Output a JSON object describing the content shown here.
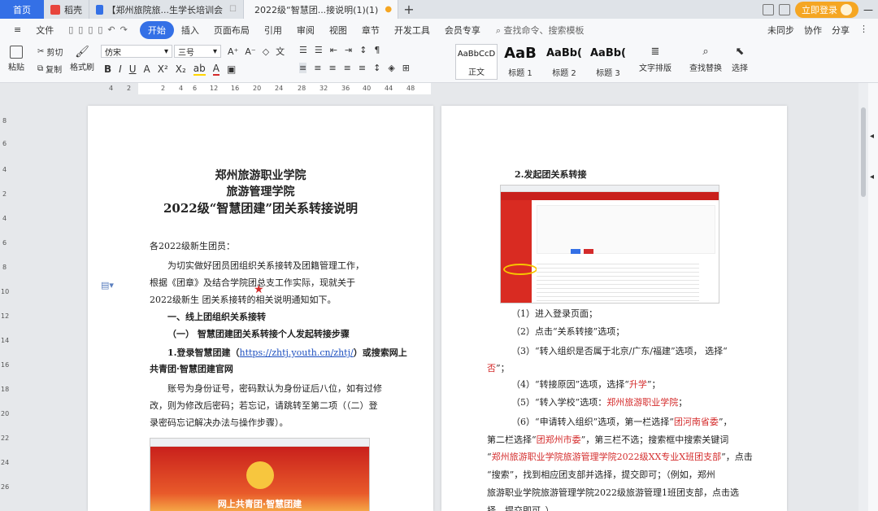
{
  "tabs": {
    "home": "首页",
    "t1": "稻壳",
    "t2": "【郑州旅院旅...生学长培训会",
    "t3": "2022级“智慧团...接说明(1)(1)",
    "add": "+",
    "login": "立即登录"
  },
  "menu": {
    "file": "文件",
    "items": [
      "开始",
      "插入",
      "页面布局",
      "引用",
      "审阅",
      "视图",
      "章节",
      "开发工具",
      "会员专享"
    ],
    "search": "查找命令、搜索模板",
    "right": [
      "未同步",
      "协作",
      "分享"
    ]
  },
  "ribbon": {
    "paste": "粘贴",
    "cut": "剪切",
    "copy": "复制",
    "format_painter": "格式刷",
    "font": "仿宋",
    "size": "三号",
    "styles": [
      {
        "preview": "AaBbCcD",
        "name": "正文"
      },
      {
        "preview": "AaB",
        "name": "标题 1"
      },
      {
        "preview": "AaBb(",
        "name": "标题 2"
      },
      {
        "preview": "AaBb(",
        "name": "标题 3"
      }
    ],
    "text_layout": "文字排版",
    "find_replace": "查找替换",
    "select": "选择"
  },
  "ruler": {
    "h": [
      "4",
      "2",
      "2",
      "4",
      "6",
      "8",
      "12",
      "16",
      "20",
      "24",
      "28",
      "32",
      "36",
      "40",
      "44",
      "48"
    ],
    "v": [
      "8",
      "6",
      "4",
      "2",
      "4",
      "6",
      "8",
      "10",
      "12",
      "14",
      "16",
      "18",
      "20",
      "22",
      "24",
      "26"
    ]
  },
  "left_page": {
    "title1": "郑州旅游职业学院",
    "title2": "旅游管理学院",
    "title3": "2022级“智慧团建”团关系转接说明",
    "greeting": "各2022级新生团员：",
    "p1": "为切实做好团员团组织关系接转及团籍管理工作，",
    "p2": "根据《团章》及结合学院团总支工作实际，现就关于",
    "p3": "2022级新生 团关系接转的相关说明通知如下。",
    "h1": "一、线上团组织关系接转",
    "h2": "（一）  智慧团建团关系转接个人发起转接步骤",
    "h3_prefix": "1.登录智慧团建（",
    "h3_link": "https://zhtj.youth.cn/zhtj/",
    "h3_suffix": "）或搜索网上",
    "h3b": "共青团·智慧团建官网",
    "p4": "账号为身份证号，密码默认为身份证后八位，如有过修",
    "p5": "改，则为修改后密码；若忘记，请跳转至第二项（（二）登",
    "p6": "录密码忘记解决办法与操作步骤）。",
    "banner": "网上共青团·智慧团建"
  },
  "right_page": {
    "h1": "2.发起团关系转接",
    "s1": "（1）进入登录页面；",
    "s2": "（2）点击“关系转接”选项；",
    "s3a": "（3）“转入组织是否属于北京/广东/福建”选项，  选择“",
    "s3b": "否",
    "s3c": "”；",
    "s4a": "（4）“转接原因”选项，选择“",
    "s4b": "升学",
    "s4c": "”；",
    "s5a": "（5）“转入学校”选项：",
    "s5b": "郑州旅游职业学院",
    "s5c": "；",
    "s6a": "（6）“申请转入组织”选项，第一栏选择“",
    "s6b": "团河南省委",
    "s6c": "”，",
    "s7a": "第二栏选择“",
    "s7b": "团郑州市委",
    "s7c": "”，第三栏不选；搜索框中搜索关键词",
    "s8a": "“",
    "s8b": "郑州旅游职业学院旅游管理学院2022级XX专业X班团支部",
    "s8c": "”，点击",
    "s9": "“搜索”，找到相应团支部并选择，提交即可；（例如，郑州",
    "s10": "旅游职业学院旅游管理学院2022级旅游管理1班团支部，点击选",
    "s11": "择，提交即可。）"
  }
}
